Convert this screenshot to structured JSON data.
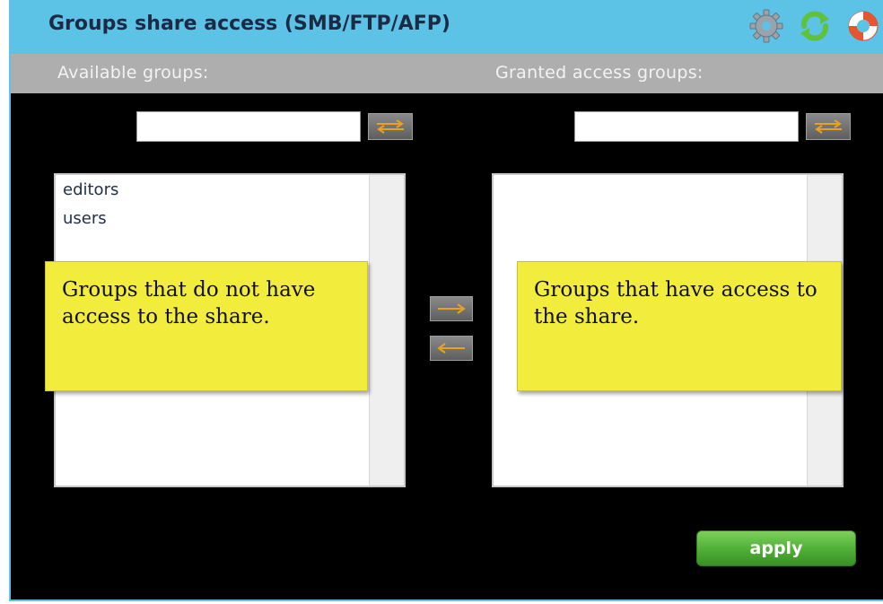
{
  "window": {
    "title": "Groups share access (SMB/FTP/AFP)",
    "icons": [
      "gear-icon",
      "refresh-icon",
      "help-lifebuoy-icon"
    ]
  },
  "available": {
    "header": "Available groups:",
    "filter_value": "",
    "items": [
      {
        "label": "editors"
      },
      {
        "label": "users"
      }
    ],
    "callout": "Groups that do not have access to the share."
  },
  "granted": {
    "header": "Granted access groups:",
    "filter_value": "",
    "items": [],
    "callout": "Groups that have access to the share."
  },
  "actions": {
    "apply_label": "apply"
  },
  "colors": {
    "title_bar": "#5cc3e6",
    "subheader": "#aeaeae",
    "background": "#000000",
    "callout": "#f2ec3c",
    "apply": "#4fae37",
    "arrow": "#e8a21f"
  }
}
